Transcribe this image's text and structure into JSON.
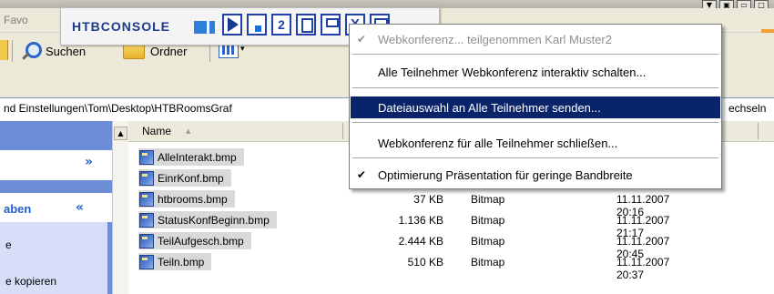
{
  "window": {
    "controls": [
      "▼",
      "▣",
      "▭",
      "□"
    ]
  },
  "menubar": {
    "favorites_label": "Favo"
  },
  "htbconsole": {
    "title": "HTBCONSOLE",
    "number_button": "2",
    "close_button": "X"
  },
  "toolbar": {
    "search_label": "Suchen",
    "folders_label": "Ordner",
    "views_chevron": "▾"
  },
  "address": {
    "path": "nd Einstellungen\\Tom\\Desktop\\HTBRoomsGraf",
    "go_label": "echseln"
  },
  "taskpane": {
    "section1_chevron": "»",
    "section2_label": "aben",
    "section2_chevron": "«",
    "item1": "e",
    "item2": "e kopieren"
  },
  "filelist": {
    "header_name": "Name",
    "sort_indicator": "▲",
    "files": [
      {
        "name": "AlleInterakt.bmp",
        "size": "",
        "type": "",
        "date": ""
      },
      {
        "name": "EinrKonf.bmp",
        "size": "",
        "type": "",
        "date": ""
      },
      {
        "name": "htbrooms.bmp",
        "size": "37 KB",
        "type": "Bitmap",
        "date": "11.11.2007 20:16"
      },
      {
        "name": "StatusKonfBeginn.bmp",
        "size": "1.136 KB",
        "type": "Bitmap",
        "date": "11.11.2007 21:17"
      },
      {
        "name": "TeilAufgesch.bmp",
        "size": "2.444 KB",
        "type": "Bitmap",
        "date": "11.11.2007 20:45"
      },
      {
        "name": "Teiln.bmp",
        "size": "510 KB",
        "type": "Bitmap",
        "date": "11.11.2007 20:37"
      }
    ]
  },
  "context_menu": {
    "items": [
      {
        "label": "Webkonferenz... teilgenommen Karl Muster2",
        "checked": true,
        "check_mark": "✔",
        "disabled": true
      },
      {
        "label": "Alle Teilnehmer Webkonferenz interaktiv schalten...",
        "checked": false,
        "check_mark": "",
        "disabled": false
      },
      {
        "label": "Dateiauswahl an Alle Teilnehmer senden...",
        "checked": false,
        "check_mark": "",
        "disabled": false,
        "selected": true
      },
      {
        "label": "Webkonferenz für alle Teilnehmer schließen...",
        "checked": false,
        "check_mark": "",
        "disabled": false
      },
      {
        "label": "Optimierung Präsentation für geringe Bandbreite",
        "checked": true,
        "check_mark": "✔",
        "disabled": false
      }
    ]
  },
  "colors": {
    "menu_highlight": "#0a246a",
    "taskpane_blue": "#6d8ed6",
    "console_blue": "#1f40a8",
    "file_highlight": "#d9d9d9"
  }
}
